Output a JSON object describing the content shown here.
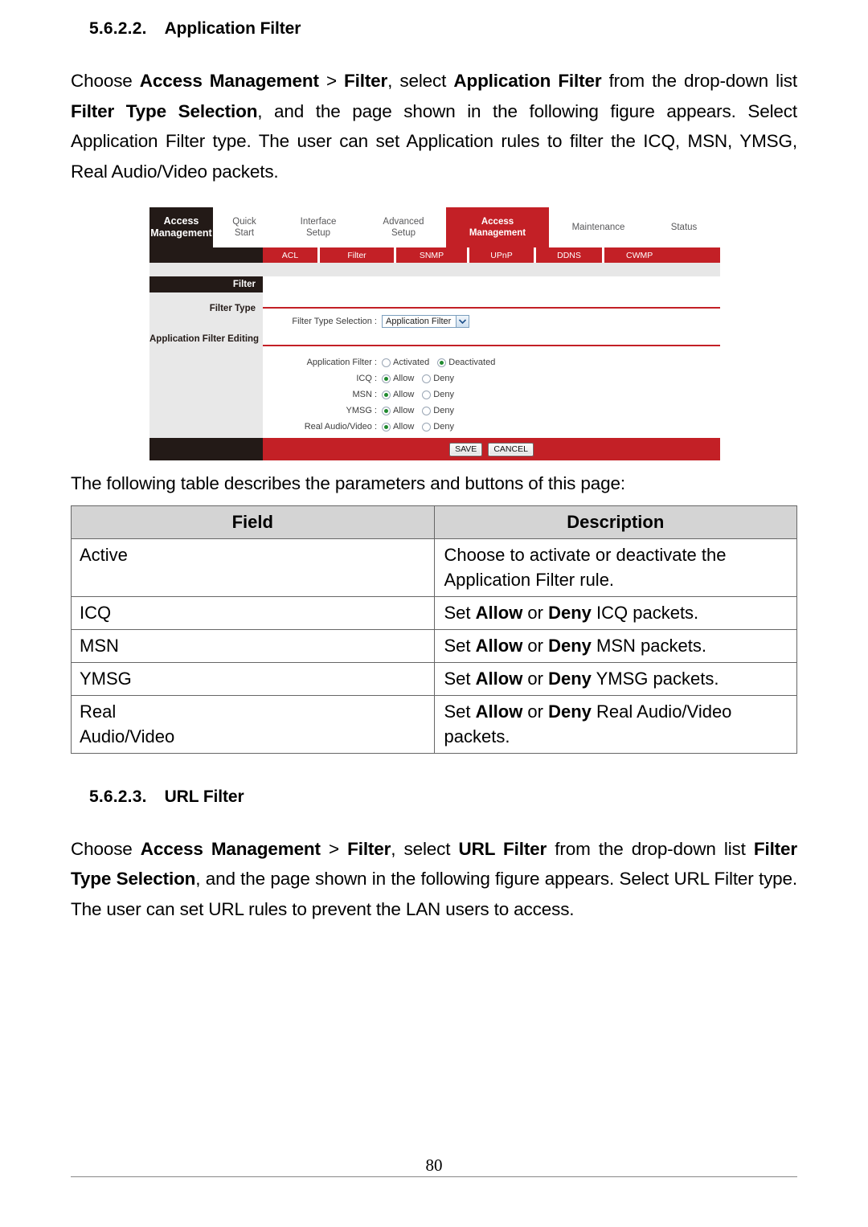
{
  "section_1": {
    "number": "5.6.2.2.",
    "title": "Application Filter",
    "paragraph_parts": {
      "p1": "Choose ",
      "b1": "Access Management",
      "p2": " > ",
      "b2": "Filter",
      "p3": ", select ",
      "b3": "Application Filter",
      "p4": " from the drop-down list ",
      "b4": "Filter Type Selection",
      "p5": ", and the page shown in the following figure appears. Select Application Filter type. The user can set Application rules to filter the ICQ, MSN, YMSG, Real Audio/Video packets."
    }
  },
  "figure": {
    "brand": {
      "line1": "Access",
      "line2": "Management"
    },
    "main_tabs": [
      {
        "label": "Quick\nStart",
        "active": false
      },
      {
        "label": "Interface\nSetup",
        "active": false
      },
      {
        "label": "Advanced\nSetup",
        "active": false
      },
      {
        "label": "Access\nManagement",
        "active": true
      },
      {
        "label": "Maintenance",
        "active": false
      },
      {
        "label": "Status",
        "active": false
      }
    ],
    "sub_tabs": [
      {
        "label": "ACL"
      },
      {
        "label": "Filter"
      },
      {
        "label": "SNMP"
      },
      {
        "label": "UPnP"
      },
      {
        "label": "DDNS"
      },
      {
        "label": "CWMP"
      }
    ],
    "left_panel": {
      "title": "Filter",
      "section_1": "Filter Type",
      "section_2": "Application Filter Editing"
    },
    "filter_type": {
      "label": "Filter Type Selection :",
      "selected": "Application Filter"
    },
    "rows": [
      {
        "label": "Application Filter :",
        "options": [
          {
            "text": "Activated",
            "checked": false
          },
          {
            "text": "Deactivated",
            "checked": true
          }
        ]
      },
      {
        "label": "ICQ :",
        "options": [
          {
            "text": "Allow",
            "checked": true
          },
          {
            "text": "Deny",
            "checked": false
          }
        ]
      },
      {
        "label": "MSN :",
        "options": [
          {
            "text": "Allow",
            "checked": true
          },
          {
            "text": "Deny",
            "checked": false
          }
        ]
      },
      {
        "label": "YMSG :",
        "options": [
          {
            "text": "Allow",
            "checked": true
          },
          {
            "text": "Deny",
            "checked": false
          }
        ]
      },
      {
        "label": "Real Audio/Video :",
        "options": [
          {
            "text": "Allow",
            "checked": true
          },
          {
            "text": "Deny",
            "checked": false
          }
        ]
      }
    ],
    "buttons": {
      "save": "SAVE",
      "cancel": "CANCEL"
    },
    "colors": {
      "accent_red": "#C32026",
      "dark_panel": "#231A17",
      "left_panel_gray": "#E8E8E8"
    }
  },
  "table_intro": "The following table describes the parameters and buttons of this page:",
  "param_table": {
    "headers": [
      "Field",
      "Description"
    ],
    "rows": [
      {
        "field": "Active",
        "field_line2": "",
        "desc_pre": "Choose to activate or deactivate the Application Filter rule.",
        "desc_b1": "",
        "desc_mid": "",
        "desc_b2": "",
        "desc_post": "",
        "plain": true
      },
      {
        "field": "ICQ",
        "field_line2": "",
        "desc_pre": "Set ",
        "desc_b1": "Allow",
        "desc_mid": " or ",
        "desc_b2": "Deny",
        "desc_post": " ICQ packets.",
        "plain": false
      },
      {
        "field": "MSN",
        "field_line2": "",
        "desc_pre": "Set ",
        "desc_b1": "Allow",
        "desc_mid": " or ",
        "desc_b2": "Deny",
        "desc_post": " MSN packets.",
        "plain": false
      },
      {
        "field": "YMSG",
        "field_line2": "",
        "desc_pre": "Set ",
        "desc_b1": "Allow",
        "desc_mid": " or ",
        "desc_b2": "Deny",
        "desc_post": " YMSG packets.",
        "plain": false
      },
      {
        "field": "Real",
        "field_line2": "Audio/Video",
        "desc_pre": "Set ",
        "desc_b1": "Allow",
        "desc_mid": " or ",
        "desc_b2": "Deny",
        "desc_post": " Real Audio/Video packets.",
        "plain": false
      }
    ]
  },
  "section_2": {
    "number": "5.6.2.3.",
    "title": "URL Filter",
    "paragraph_parts": {
      "p1": "Choose ",
      "b1": "Access Management",
      "p2": " > ",
      "b2": "Filter",
      "p3": ", select ",
      "b3": "URL Filter",
      "p4": " from the drop-down list ",
      "b4": "Filter Type Selection",
      "p5": ", and the page shown in the following figure appears. Select URL Filter type. The user can set URL rules to prevent the LAN users to access."
    }
  },
  "footer": {
    "page_number": "80"
  }
}
